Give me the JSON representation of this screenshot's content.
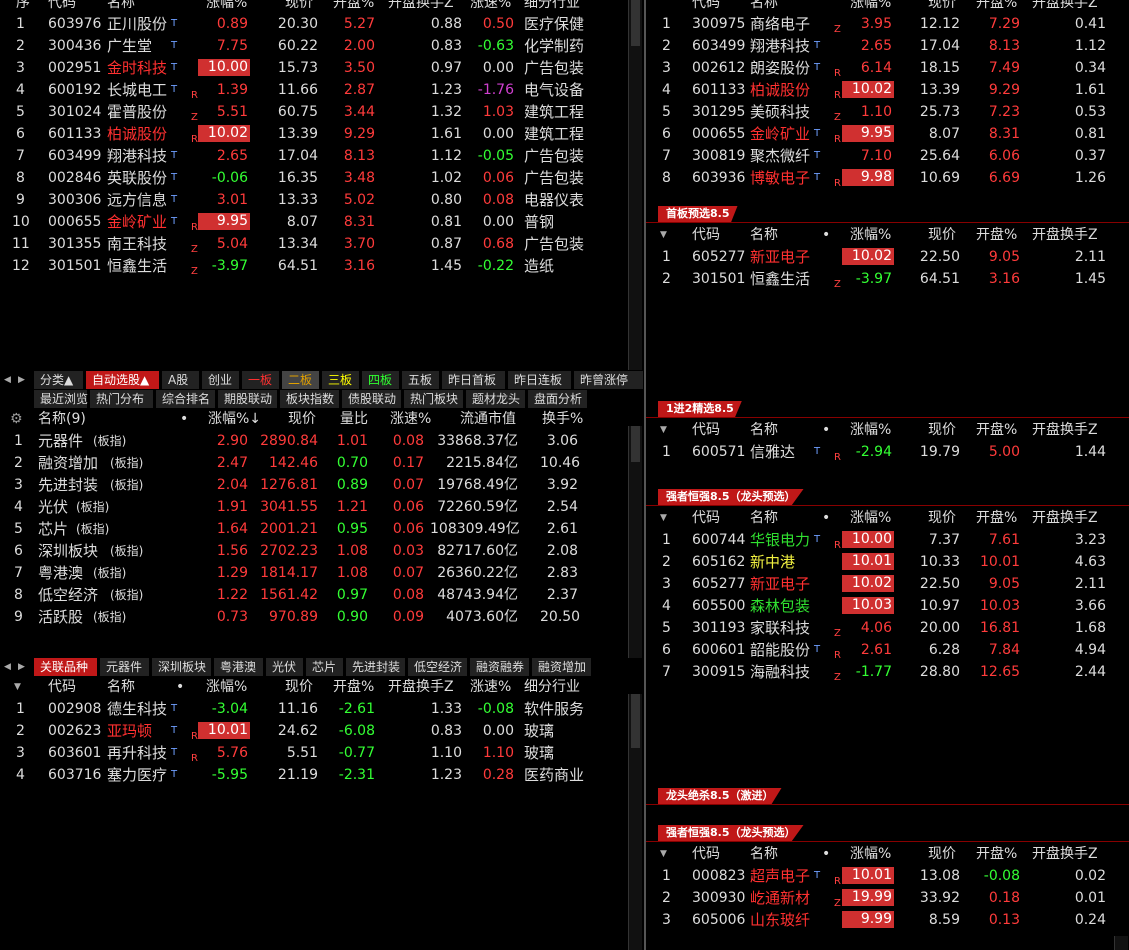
{
  "left_top": {
    "headers": [
      "序",
      "代码",
      "名称",
      "涨幅%",
      "现价",
      "开盘%",
      "开盘换手Z",
      "涨速%",
      "细分行业"
    ],
    "rows": [
      {
        "seq": "1",
        "code": "603976",
        "name": "正川股份",
        "flag": "T",
        "mark": "",
        "chg": "0.89",
        "price": "20.30",
        "open": "5.27",
        "turn": "0.88",
        "speed": "0.50",
        "ind": "医疗保健",
        "hl": true,
        "chgc": "red",
        "openc": "red",
        "speedc": "red",
        "namec": "white",
        "box": false
      },
      {
        "seq": "2",
        "code": "300436",
        "name": "广生堂",
        "flag": "T",
        "mark": "",
        "chg": "7.75",
        "price": "60.22",
        "open": "2.00",
        "turn": "0.83",
        "speed": "-0.63",
        "ind": "化学制药",
        "chgc": "red",
        "openc": "red",
        "speedc": "green",
        "namec": "white",
        "box": false
      },
      {
        "seq": "3",
        "code": "002951",
        "name": "金时科技",
        "flag": "T",
        "mark": "",
        "chg": "10.00",
        "price": "15.73",
        "open": "3.50",
        "turn": "0.97",
        "speed": "0.00",
        "ind": "广告包装",
        "chgc": "red",
        "openc": "red",
        "speedc": "white",
        "namec": "redname",
        "box": true
      },
      {
        "seq": "4",
        "code": "600192",
        "name": "长城电工",
        "flag": "T",
        "mark": "R",
        "chg": "1.39",
        "price": "11.66",
        "open": "2.87",
        "turn": "1.23",
        "speed": "-1.76",
        "ind": "电气设备",
        "chgc": "red",
        "openc": "red",
        "speedc": "purple",
        "namec": "white",
        "box": false
      },
      {
        "seq": "5",
        "code": "301024",
        "name": "霍普股份",
        "flag": "",
        "mark": "Z",
        "chg": "5.51",
        "price": "60.75",
        "open": "3.44",
        "turn": "1.32",
        "speed": "1.03",
        "ind": "建筑工程",
        "chgc": "red",
        "openc": "red",
        "speedc": "red",
        "namec": "white",
        "box": false
      },
      {
        "seq": "6",
        "code": "601133",
        "name": "柏诚股份",
        "flag": "",
        "mark": "R",
        "chg": "10.02",
        "price": "13.39",
        "open": "9.29",
        "turn": "1.61",
        "speed": "0.00",
        "ind": "建筑工程",
        "chgc": "red",
        "openc": "red",
        "speedc": "white",
        "namec": "redname",
        "box": true
      },
      {
        "seq": "7",
        "code": "603499",
        "name": "翔港科技",
        "flag": "T",
        "mark": "",
        "chg": "2.65",
        "price": "17.04",
        "open": "8.13",
        "turn": "1.12",
        "speed": "-0.05",
        "ind": "广告包装",
        "chgc": "red",
        "openc": "red",
        "speedc": "green",
        "namec": "white",
        "box": false
      },
      {
        "seq": "8",
        "code": "002846",
        "name": "英联股份",
        "flag": "T",
        "mark": "",
        "chg": "-0.06",
        "price": "16.35",
        "open": "3.48",
        "turn": "1.02",
        "speed": "0.06",
        "ind": "广告包装",
        "chgc": "green",
        "openc": "red",
        "speedc": "red",
        "namec": "white",
        "box": false
      },
      {
        "seq": "9",
        "code": "300306",
        "name": "远方信息",
        "flag": "T",
        "mark": "",
        "chg": "3.01",
        "price": "13.33",
        "open": "5.02",
        "turn": "0.80",
        "speed": "0.08",
        "ind": "电器仪表",
        "chgc": "red",
        "openc": "red",
        "speedc": "red",
        "namec": "white",
        "box": false
      },
      {
        "seq": "10",
        "code": "000655",
        "name": "金岭矿业",
        "flag": "T",
        "mark": "R",
        "chg": "9.95",
        "price": "8.07",
        "open": "8.31",
        "turn": "0.81",
        "speed": "0.00",
        "ind": "普钢",
        "chgc": "red",
        "openc": "red",
        "speedc": "white",
        "namec": "redname",
        "box": true
      },
      {
        "seq": "11",
        "code": "301355",
        "name": "南王科技",
        "flag": "",
        "mark": "Z",
        "chg": "5.04",
        "price": "13.34",
        "open": "3.70",
        "turn": "0.87",
        "speed": "0.68",
        "ind": "广告包装",
        "chgc": "red",
        "openc": "red",
        "speedc": "red",
        "namec": "white",
        "box": false
      },
      {
        "seq": "12",
        "code": "301501",
        "name": "恒鑫生活",
        "flag": "",
        "mark": "Z",
        "chg": "-3.97",
        "price": "64.51",
        "open": "3.16",
        "turn": "1.45",
        "speed": "-0.22",
        "ind": "造纸",
        "chgc": "green",
        "openc": "red",
        "speedc": "green",
        "namec": "white",
        "box": false
      }
    ]
  },
  "tabs1": [
    "分类▲",
    "自动选股▲",
    "A股",
    "创业",
    "一板",
    "二板",
    "三板",
    "四板",
    "五板",
    "昨日首板",
    "昨日连板",
    "昨曾涨停"
  ],
  "tabs2": [
    "最近浏览",
    "热门分布",
    "综合排名",
    "期股联动",
    "板块指数",
    "债股联动",
    "热门板块",
    "题材龙头",
    "盘面分析"
  ],
  "sector": {
    "headers": [
      "名称(9)",
      "涨幅%↓",
      "现价",
      "量比",
      "涨速%",
      "流通市值",
      "换手%"
    ],
    "rows": [
      {
        "seq": "1",
        "name": "元器件",
        "tag": "(板指)",
        "chg": "2.90",
        "price": "2890.84",
        "vr": "1.01",
        "speed": "0.08",
        "cap": "33868.37亿",
        "turn": "3.06",
        "vrc": "red"
      },
      {
        "seq": "2",
        "name": "融资增加",
        "tag": "(板指)",
        "chg": "2.47",
        "price": "142.46",
        "vr": "0.70",
        "speed": "0.17",
        "cap": "2215.84亿",
        "turn": "10.46",
        "vrc": "green"
      },
      {
        "seq": "3",
        "name": "先进封装",
        "tag": "(板指)",
        "chg": "2.04",
        "price": "1276.81",
        "vr": "0.89",
        "speed": "0.07",
        "cap": "19768.49亿",
        "turn": "3.92",
        "vrc": "green"
      },
      {
        "seq": "4",
        "name": "光伏",
        "tag": "(板指)",
        "chg": "1.91",
        "price": "3041.55",
        "vr": "1.21",
        "speed": "0.06",
        "cap": "72260.59亿",
        "turn": "2.54",
        "vrc": "red"
      },
      {
        "seq": "5",
        "name": "芯片",
        "tag": "(板指)",
        "chg": "1.64",
        "price": "2001.21",
        "vr": "0.95",
        "speed": "0.06",
        "cap": "108309.49亿",
        "turn": "2.61",
        "vrc": "green"
      },
      {
        "seq": "6",
        "name": "深圳板块",
        "tag": "(板指)",
        "chg": "1.56",
        "price": "2702.23",
        "vr": "1.08",
        "speed": "0.03",
        "cap": "82717.60亿",
        "turn": "2.08",
        "vrc": "red"
      },
      {
        "seq": "7",
        "name": "粤港澳",
        "tag": "(板指)",
        "chg": "1.29",
        "price": "1814.17",
        "vr": "1.08",
        "speed": "0.07",
        "cap": "26360.22亿",
        "turn": "2.83",
        "vrc": "red"
      },
      {
        "seq": "8",
        "name": "低空经济",
        "tag": "(板指)",
        "chg": "1.22",
        "price": "1561.42",
        "vr": "0.97",
        "speed": "0.08",
        "cap": "48743.94亿",
        "turn": "2.37",
        "vrc": "green"
      },
      {
        "seq": "9",
        "name": "活跃股",
        "tag": "(板指)",
        "chg": "0.73",
        "price": "970.89",
        "vr": "0.90",
        "speed": "0.09",
        "cap": "4073.60亿",
        "turn": "20.50",
        "vrc": "green"
      }
    ]
  },
  "tabs3": [
    "关联品种",
    "元器件",
    "深圳板块",
    "粤港澳",
    "光伏",
    "芯片",
    "先进封装",
    "低空经济",
    "融资融券",
    "融资增加"
  ],
  "related": {
    "headers": [
      "代码",
      "名称",
      "涨幅%",
      "现价",
      "开盘%",
      "开盘换手Z",
      "涨速%",
      "细分行业"
    ],
    "rows": [
      {
        "seq": "1",
        "code": "002908",
        "name": "德生科技",
        "flag": "T",
        "mark": "",
        "chg": "-3.04",
        "price": "11.16",
        "open": "-2.61",
        "turn": "1.33",
        "speed": "-0.08",
        "ind": "软件服务",
        "hl": true,
        "chgc": "green",
        "openc": "green",
        "speedc": "green",
        "namec": "white",
        "box": false
      },
      {
        "seq": "2",
        "code": "002623",
        "name": "亚玛顿",
        "flag": "T",
        "mark": "R",
        "chg": "10.01",
        "price": "24.62",
        "open": "-6.08",
        "turn": "0.83",
        "speed": "0.00",
        "ind": "玻璃",
        "chgc": "red",
        "openc": "green",
        "speedc": "white",
        "namec": "redname",
        "box": true
      },
      {
        "seq": "3",
        "code": "603601",
        "name": "再升科技",
        "flag": "T",
        "mark": "R",
        "chg": "5.76",
        "price": "5.51",
        "open": "-0.77",
        "turn": "1.10",
        "speed": "1.10",
        "ind": "玻璃",
        "chgc": "red",
        "openc": "green",
        "speedc": "red",
        "namec": "white",
        "box": false
      },
      {
        "seq": "4",
        "code": "603716",
        "name": "塞力医疗",
        "flag": "T",
        "mark": "",
        "chg": "-5.95",
        "price": "21.19",
        "open": "-2.31",
        "turn": "1.23",
        "speed": "0.28",
        "ind": "医药商业",
        "chgc": "green",
        "openc": "green",
        "speedc": "red",
        "namec": "white",
        "box": false
      }
    ]
  },
  "right_top": {
    "headers": [
      "代码",
      "名称",
      "涨幅%",
      "现价",
      "开盘%",
      "开盘换手Z"
    ],
    "rows": [
      {
        "seq": "1",
        "code": "300975",
        "name": "商络电子",
        "flag": "",
        "mark": "Z",
        "chg": "3.95",
        "price": "12.12",
        "open": "7.29",
        "turn": "0.41",
        "hl": true,
        "chgc": "red",
        "openc": "red",
        "namec": "white",
        "box": false
      },
      {
        "seq": "2",
        "code": "603499",
        "name": "翔港科技",
        "flag": "T",
        "mark": "",
        "chg": "2.65",
        "price": "17.04",
        "open": "8.13",
        "turn": "1.12",
        "chgc": "red",
        "openc": "red",
        "namec": "white",
        "box": false
      },
      {
        "seq": "3",
        "code": "002612",
        "name": "朗姿股份",
        "flag": "T",
        "mark": "R",
        "chg": "6.14",
        "price": "18.15",
        "open": "7.49",
        "turn": "0.34",
        "chgc": "red",
        "openc": "red",
        "namec": "white",
        "box": false
      },
      {
        "seq": "4",
        "code": "601133",
        "name": "柏诚股份",
        "flag": "",
        "mark": "R",
        "chg": "10.02",
        "price": "13.39",
        "open": "9.29",
        "turn": "1.61",
        "chgc": "red",
        "openc": "red",
        "namec": "redname",
        "box": true
      },
      {
        "seq": "5",
        "code": "301295",
        "name": "美硕科技",
        "flag": "",
        "mark": "Z",
        "chg": "1.10",
        "price": "25.73",
        "open": "7.23",
        "turn": "0.53",
        "chgc": "red",
        "openc": "red",
        "namec": "white",
        "box": false
      },
      {
        "seq": "6",
        "code": "000655",
        "name": "金岭矿业",
        "flag": "T",
        "mark": "R",
        "chg": "9.95",
        "price": "8.07",
        "open": "8.31",
        "turn": "0.81",
        "chgc": "red",
        "openc": "red",
        "namec": "redname",
        "box": true
      },
      {
        "seq": "7",
        "code": "300819",
        "name": "聚杰微纤",
        "flag": "T",
        "mark": "",
        "chg": "7.10",
        "price": "25.64",
        "open": "6.06",
        "turn": "0.37",
        "chgc": "red",
        "openc": "red",
        "namec": "white",
        "box": false
      },
      {
        "seq": "8",
        "code": "603936",
        "name": "博敏电子",
        "flag": "T",
        "mark": "R",
        "chg": "9.98",
        "price": "10.69",
        "open": "6.69",
        "turn": "1.26",
        "chgc": "red",
        "openc": "red",
        "namec": "redname",
        "box": true
      }
    ]
  },
  "sect_shouban": {
    "title": "首板预选8.5",
    "rows": [
      {
        "seq": "1",
        "code": "605277",
        "name": "新亚电子",
        "flag": "",
        "mark": "",
        "chg": "10.02",
        "price": "22.50",
        "open": "9.05",
        "turn": "2.11",
        "hl": true,
        "chgc": "red",
        "openc": "red",
        "namec": "redname",
        "box": true
      },
      {
        "seq": "2",
        "code": "301501",
        "name": "恒鑫生活",
        "flag": "",
        "mark": "Z",
        "chg": "-3.97",
        "price": "64.51",
        "open": "3.16",
        "turn": "1.45",
        "chgc": "green",
        "openc": "red",
        "namec": "white",
        "box": false
      }
    ]
  },
  "sect_1jin2": {
    "title": "1进2精选8.5",
    "rows": [
      {
        "seq": "1",
        "code": "600571",
        "name": "信雅达",
        "flag": "T",
        "mark": "R",
        "chg": "-2.94",
        "price": "19.79",
        "open": "5.00",
        "turn": "1.44",
        "hl": true,
        "chgc": "green",
        "openc": "red",
        "namec": "white",
        "box": false
      }
    ]
  },
  "sect_qiang1": {
    "title": "强者恒强8.5（龙头预选）",
    "rows": [
      {
        "seq": "1",
        "code": "600744",
        "name": "华银电力",
        "flag": "T",
        "mark": "R",
        "chg": "10.00",
        "price": "7.37",
        "open": "7.61",
        "turn": "3.23",
        "hl": true,
        "chgc": "red",
        "openc": "red",
        "namec": "greenname",
        "box": true
      },
      {
        "seq": "2",
        "code": "605162",
        "name": "新中港",
        "flag": "",
        "mark": "",
        "chg": "10.01",
        "price": "10.33",
        "open": "10.01",
        "turn": "4.63",
        "chgc": "red",
        "openc": "red",
        "namec": "yellowname",
        "box": true
      },
      {
        "seq": "3",
        "code": "605277",
        "name": "新亚电子",
        "flag": "",
        "mark": "",
        "chg": "10.02",
        "price": "22.50",
        "open": "9.05",
        "turn": "2.11",
        "chgc": "red",
        "openc": "red",
        "namec": "redname",
        "box": true
      },
      {
        "seq": "4",
        "code": "605500",
        "name": "森林包装",
        "flag": "",
        "mark": "",
        "chg": "10.03",
        "price": "10.97",
        "open": "10.03",
        "turn": "3.66",
        "chgc": "red",
        "openc": "red",
        "namec": "greenname",
        "box": true
      },
      {
        "seq": "5",
        "code": "301193",
        "name": "家联科技",
        "flag": "",
        "mark": "Z",
        "chg": "4.06",
        "price": "20.00",
        "open": "16.81",
        "turn": "1.68",
        "chgc": "red",
        "openc": "red",
        "namec": "white",
        "box": false
      },
      {
        "seq": "6",
        "code": "600601",
        "name": "韶能股份",
        "flag": "T",
        "mark": "R",
        "chg": "2.61",
        "price": "6.28",
        "open": "7.84",
        "turn": "4.94",
        "chgc": "red",
        "openc": "red",
        "namec": "white",
        "box": false
      },
      {
        "seq": "7",
        "code": "300915",
        "name": "海融科技",
        "flag": "",
        "mark": "Z",
        "chg": "-1.77",
        "price": "28.80",
        "open": "12.65",
        "turn": "2.44",
        "chgc": "green",
        "openc": "red",
        "namec": "white",
        "box": false
      }
    ]
  },
  "sect_longtou": {
    "title": "龙头绝杀8.5（激进）"
  },
  "sect_qiang2": {
    "title": "强者恒强8.5（龙头预选）",
    "rows": [
      {
        "seq": "1",
        "code": "000823",
        "name": "超声电子",
        "flag": "T",
        "mark": "R",
        "chg": "10.01",
        "price": "13.08",
        "open": "-0.08",
        "turn": "0.02",
        "hl": true,
        "chgc": "red",
        "openc": "green",
        "namec": "redname",
        "box": true
      },
      {
        "seq": "2",
        "code": "300930",
        "name": "屹通新材",
        "flag": "",
        "mark": "Z",
        "chg": "19.99",
        "price": "33.92",
        "open": "0.18",
        "turn": "0.01",
        "chgc": "red",
        "openc": "red",
        "namec": "redname",
        "box": true
      },
      {
        "seq": "3",
        "code": "605006",
        "name": "山东玻纤",
        "flag": "",
        "mark": "",
        "chg": "9.99",
        "price": "8.59",
        "open": "0.13",
        "turn": "0.24",
        "chgc": "red",
        "openc": "red",
        "namec": "redname",
        "box": true
      }
    ]
  }
}
